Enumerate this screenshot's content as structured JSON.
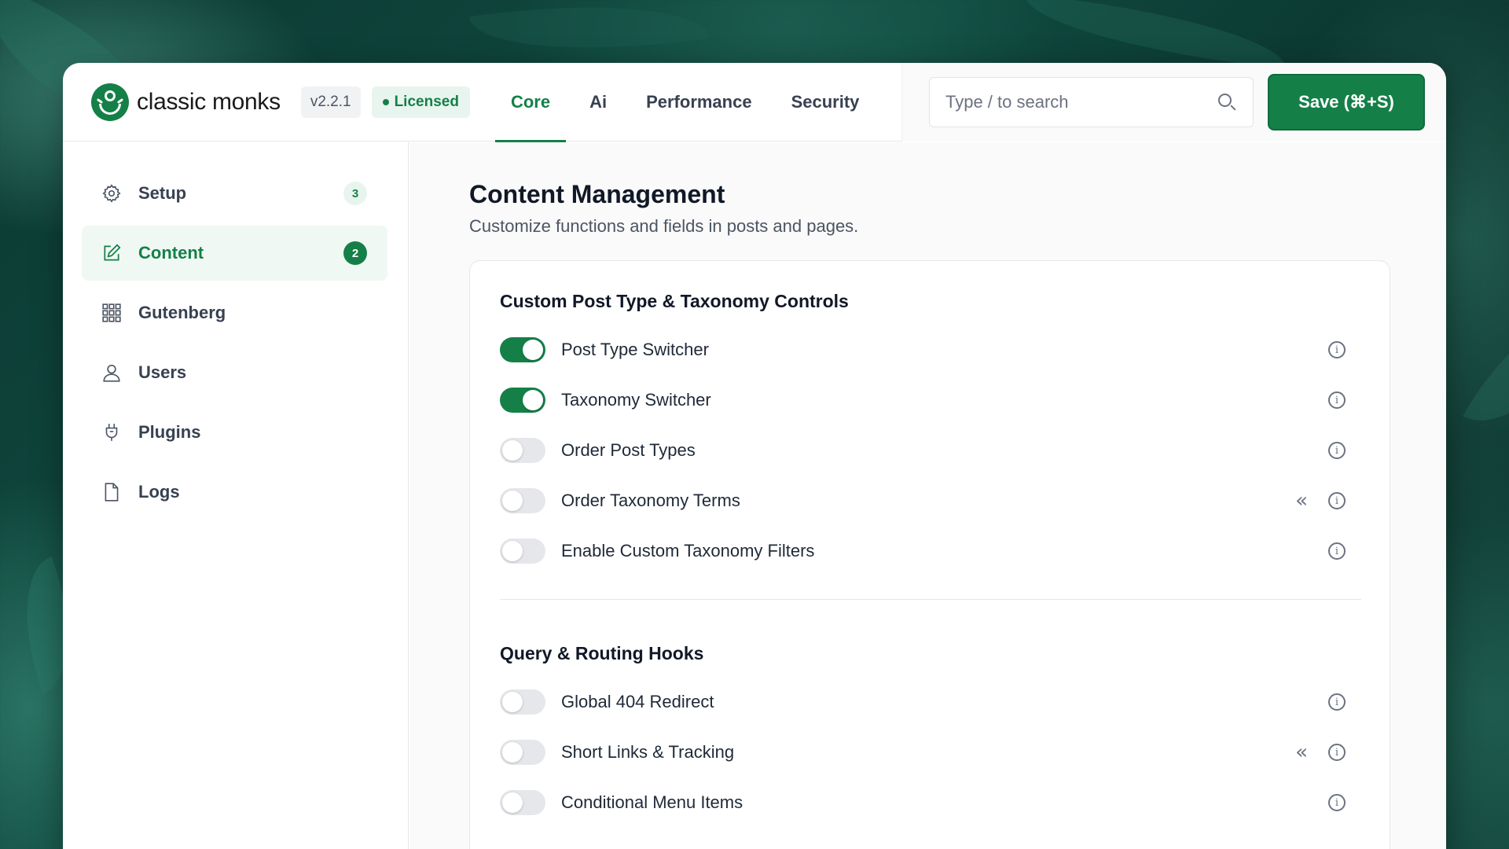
{
  "brand": {
    "name": "classic monks",
    "version": "v2.2.1",
    "license": "Licensed"
  },
  "nav": {
    "tabs": [
      "Core",
      "Ai",
      "Performance",
      "Security"
    ],
    "active": "Core"
  },
  "search": {
    "placeholder": "Type / to search"
  },
  "toolbar": {
    "save_label": "Save (⌘+S)"
  },
  "sidebar": {
    "items": [
      {
        "label": "Setup",
        "icon": "gear-icon",
        "badge": "3",
        "active": false
      },
      {
        "label": "Content",
        "icon": "edit-icon",
        "badge": "2",
        "active": true
      },
      {
        "label": "Gutenberg",
        "icon": "grid-icon",
        "badge": null,
        "active": false
      },
      {
        "label": "Users",
        "icon": "user-icon",
        "badge": null,
        "active": false
      },
      {
        "label": "Plugins",
        "icon": "plug-icon",
        "badge": null,
        "active": false
      },
      {
        "label": "Logs",
        "icon": "file-icon",
        "badge": null,
        "active": false
      }
    ]
  },
  "main": {
    "title": "Content Management",
    "subtitle": "Customize functions and fields in posts and pages.",
    "sections": [
      {
        "title": "Custom Post Type & Taxonomy Controls",
        "rows": [
          {
            "label": "Post Type Switcher",
            "enabled": true,
            "collapse": false
          },
          {
            "label": "Taxonomy Switcher",
            "enabled": true,
            "collapse": false
          },
          {
            "label": "Order Post Types",
            "enabled": false,
            "collapse": false
          },
          {
            "label": "Order Taxonomy Terms",
            "enabled": false,
            "collapse": true
          },
          {
            "label": "Enable Custom Taxonomy Filters",
            "enabled": false,
            "collapse": false
          }
        ]
      },
      {
        "title": "Query & Routing Hooks",
        "rows": [
          {
            "label": "Global 404 Redirect",
            "enabled": false,
            "collapse": false
          },
          {
            "label": "Short Links & Tracking",
            "enabled": false,
            "collapse": true
          },
          {
            "label": "Conditional Menu Items",
            "enabled": false,
            "collapse": false
          }
        ]
      }
    ]
  },
  "colors": {
    "accent": "#148048",
    "accent_light": "#e8f5ee",
    "toggle_off": "#e5e7eb"
  }
}
